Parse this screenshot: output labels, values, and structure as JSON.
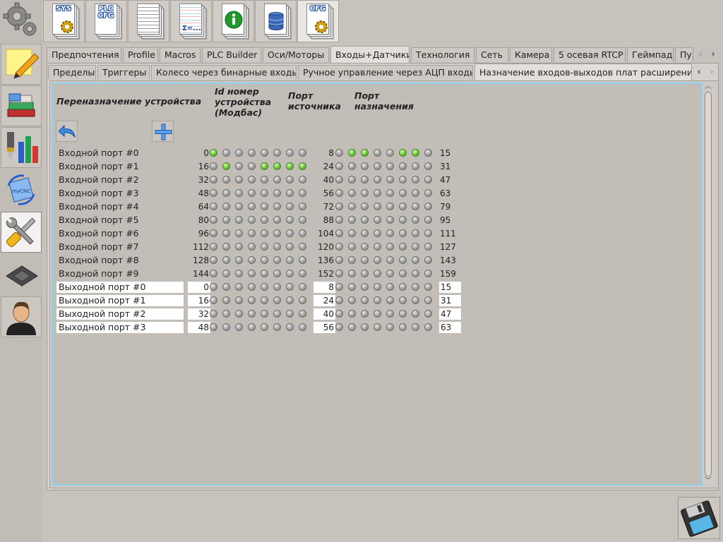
{
  "toolbar": {
    "buttons": [
      {
        "label": "SYS",
        "name": "sys"
      },
      {
        "label": "PLC\nCFG",
        "name": "plc-cfg"
      },
      {
        "label": "",
        "name": "document"
      },
      {
        "label": "",
        "name": "formula-sheet"
      },
      {
        "label": "",
        "name": "info"
      },
      {
        "label": "",
        "name": "database"
      },
      {
        "label": "CFG",
        "name": "cfg"
      }
    ],
    "formula_text": "Σ=..."
  },
  "main_tabs": {
    "items": [
      "Предпочтения",
      "Profile",
      "Macros",
      "PLC Builder",
      "Оси/Моторы",
      "Входы+Датчики",
      "Технология",
      "Сеть",
      "Камера",
      "5 осевая RTCP",
      "Геймпад",
      "Пуль"
    ],
    "active": "Входы+Датчики"
  },
  "sub_tabs": {
    "items": [
      "Пределы",
      "Триггеры",
      "Колесо через бинарные входы",
      "Ручное управление через АЦП входы",
      "Назначение входов-выходов плат расширения"
    ],
    "active": "Назначение входов-выходов плат расширения"
  },
  "headers": {
    "reassign": "Переназначение устройства",
    "device_id": "Id номер\nустройства\n(Модбас)",
    "source_port": "Порт\nисточника",
    "dest_port": "Порт\nназначения"
  },
  "rows": [
    {
      "label": "Входной порт #0",
      "type": "input",
      "src_start": "0",
      "src_leds": [
        1,
        0,
        0,
        0,
        0,
        0,
        0,
        0
      ],
      "dst_start": "8",
      "dst_leds": [
        0,
        1,
        1,
        0,
        0,
        1,
        1,
        0
      ],
      "dst_end": "15"
    },
    {
      "label": "Входной порт #1",
      "type": "input",
      "src_start": "16",
      "src_leds": [
        0,
        1,
        0,
        0,
        1,
        1,
        1,
        1
      ],
      "dst_start": "24",
      "dst_leds": [
        0,
        0,
        0,
        0,
        0,
        0,
        0,
        0
      ],
      "dst_end": "31"
    },
    {
      "label": "Входной порт #2",
      "type": "input",
      "src_start": "32",
      "src_leds": [
        0,
        0,
        0,
        0,
        0,
        0,
        0,
        0
      ],
      "dst_start": "40",
      "dst_leds": [
        0,
        0,
        0,
        0,
        0,
        0,
        0,
        0
      ],
      "dst_end": "47"
    },
    {
      "label": "Входной порт #3",
      "type": "input",
      "src_start": "48",
      "src_leds": [
        0,
        0,
        0,
        0,
        0,
        0,
        0,
        0
      ],
      "dst_start": "56",
      "dst_leds": [
        0,
        0,
        0,
        0,
        0,
        0,
        0,
        0
      ],
      "dst_end": "63"
    },
    {
      "label": "Входной порт #4",
      "type": "input",
      "src_start": "64",
      "src_leds": [
        0,
        0,
        0,
        0,
        0,
        0,
        0,
        0
      ],
      "dst_start": "72",
      "dst_leds": [
        0,
        0,
        0,
        0,
        0,
        0,
        0,
        0
      ],
      "dst_end": "79"
    },
    {
      "label": "Входной порт #5",
      "type": "input",
      "src_start": "80",
      "src_leds": [
        0,
        0,
        0,
        0,
        0,
        0,
        0,
        0
      ],
      "dst_start": "88",
      "dst_leds": [
        0,
        0,
        0,
        0,
        0,
        0,
        0,
        0
      ],
      "dst_end": "95"
    },
    {
      "label": "Входной порт #6",
      "type": "input",
      "src_start": "96",
      "src_leds": [
        0,
        0,
        0,
        0,
        0,
        0,
        0,
        0
      ],
      "dst_start": "104",
      "dst_leds": [
        0,
        0,
        0,
        0,
        0,
        0,
        0,
        0
      ],
      "dst_end": "111"
    },
    {
      "label": "Входной порт #7",
      "type": "input",
      "src_start": "112",
      "src_leds": [
        0,
        0,
        0,
        0,
        0,
        0,
        0,
        0
      ],
      "dst_start": "120",
      "dst_leds": [
        0,
        0,
        0,
        0,
        0,
        0,
        0,
        0
      ],
      "dst_end": "127"
    },
    {
      "label": "Входной порт #8",
      "type": "input",
      "src_start": "128",
      "src_leds": [
        0,
        0,
        0,
        0,
        0,
        0,
        0,
        0
      ],
      "dst_start": "136",
      "dst_leds": [
        0,
        0,
        0,
        0,
        0,
        0,
        0,
        0
      ],
      "dst_end": "143"
    },
    {
      "label": "Входной порт #9",
      "type": "input",
      "src_start": "144",
      "src_leds": [
        0,
        0,
        0,
        0,
        0,
        0,
        0,
        0
      ],
      "dst_start": "152",
      "dst_leds": [
        0,
        0,
        0,
        0,
        0,
        0,
        0,
        0
      ],
      "dst_end": "159"
    },
    {
      "label": "Выходной порт #0",
      "type": "output",
      "src_start": "0",
      "src_leds": [
        0,
        0,
        0,
        0,
        0,
        0,
        0,
        0
      ],
      "dst_start": "8",
      "dst_leds": [
        0,
        0,
        0,
        0,
        0,
        0,
        0,
        0
      ],
      "dst_end": "15"
    },
    {
      "label": "Выходной порт #1",
      "type": "output",
      "src_start": "16",
      "src_leds": [
        0,
        0,
        0,
        0,
        0,
        0,
        0,
        0
      ],
      "dst_start": "24",
      "dst_leds": [
        0,
        0,
        0,
        0,
        0,
        0,
        0,
        0
      ],
      "dst_end": "31"
    },
    {
      "label": "Выходной порт #2",
      "type": "output",
      "src_start": "32",
      "src_leds": [
        0,
        0,
        0,
        0,
        0,
        0,
        0,
        0
      ],
      "dst_start": "40",
      "dst_leds": [
        0,
        0,
        0,
        0,
        0,
        0,
        0,
        0
      ],
      "dst_end": "47"
    },
    {
      "label": "Выходной порт #3",
      "type": "output",
      "src_start": "48",
      "src_leds": [
        0,
        0,
        0,
        0,
        0,
        0,
        0,
        0
      ],
      "dst_start": "56",
      "dst_leds": [
        0,
        0,
        0,
        0,
        0,
        0,
        0,
        0
      ],
      "dst_end": "63"
    }
  ],
  "colors": {
    "accent_frame": "#8fd0ea",
    "led_on": "#67c238",
    "led_off": "#9a9a9a",
    "background": "#c3bdb8"
  },
  "icons": {
    "sidebar": [
      "gears-icon",
      "note-pencil-icon",
      "books-icon",
      "tools-bars-icon",
      "mycnc-rotate-icon",
      "wrench-screwdriver-icon",
      "chip-icon",
      "user-icon"
    ],
    "actions": [
      "undo-icon",
      "plus-icon"
    ],
    "save": "floppy-save-icon"
  }
}
